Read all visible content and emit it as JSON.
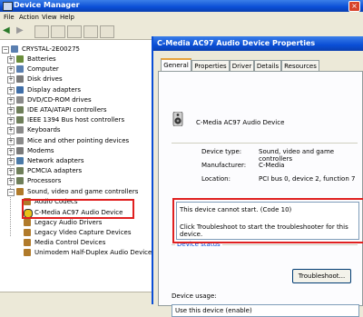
{
  "device_manager": {
    "title": "Device Manager",
    "close_glyph": "×",
    "menu": [
      "File",
      "Action",
      "View",
      "Help"
    ],
    "root": "CRYSTAL-2E00275",
    "tree": [
      {
        "label": "Batteries",
        "icon": "battery-icon",
        "color": "#6a8d3a"
      },
      {
        "label": "Computer",
        "icon": "computer-icon",
        "color": "#5a7fb0"
      },
      {
        "label": "Disk drives",
        "icon": "disk-icon",
        "color": "#7a7a7a"
      },
      {
        "label": "Display adapters",
        "icon": "display-icon",
        "color": "#3f6ea8"
      },
      {
        "label": "DVD/CD-ROM drives",
        "icon": "dvd-icon",
        "color": "#8a8a8a"
      },
      {
        "label": "IDE ATA/ATAPI controllers",
        "icon": "ide-icon",
        "color": "#6f7f5a"
      },
      {
        "label": "IEEE 1394 Bus host controllers",
        "icon": "firewire-icon",
        "color": "#6f7f5a"
      },
      {
        "label": "Keyboards",
        "icon": "keyboard-icon",
        "color": "#8a8a8a"
      },
      {
        "label": "Mice and other pointing devices",
        "icon": "mouse-icon",
        "color": "#8a8a8a"
      },
      {
        "label": "Modems",
        "icon": "modem-icon",
        "color": "#7a7a7a"
      },
      {
        "label": "Network adapters",
        "icon": "network-icon",
        "color": "#4a7aa8"
      },
      {
        "label": "PCMCIA adapters",
        "icon": "pcmcia-icon",
        "color": "#6f7f5a"
      },
      {
        "label": "Processors",
        "icon": "processor-icon",
        "color": "#6f7f5a"
      },
      {
        "label": "Sound, video and game controllers",
        "icon": "sound-icon",
        "color": "#b07a2a",
        "expanded": true
      }
    ],
    "children": [
      {
        "label": "Audio Codecs",
        "icon": "speaker-icon",
        "color": "#b07a2a"
      },
      {
        "label": "C-Media AC97 Audio Device",
        "icon": "warning-icon",
        "color": "#e8c21a"
      },
      {
        "label": "Legacy Audio Drivers",
        "icon": "speaker-icon",
        "color": "#b07a2a"
      },
      {
        "label": "Legacy Video Capture Devices",
        "icon": "speaker-icon",
        "color": "#b07a2a"
      },
      {
        "label": "Media Control Devices",
        "icon": "speaker-icon",
        "color": "#b07a2a"
      },
      {
        "label": "Unimodem Half-Duplex Audio Device",
        "icon": "speaker-icon",
        "color": "#b07a2a"
      }
    ]
  },
  "dialog": {
    "title": "C-Media AC97 Audio Device Properties",
    "tabs": [
      "General",
      "Properties",
      "Driver",
      "Details",
      "Resources"
    ],
    "device_name": "C-Media AC97 Audio Device",
    "props": [
      {
        "key": "Device type:",
        "value": "Sound, video and game controllers"
      },
      {
        "key": "Manufacturer:",
        "value": "C-Media"
      },
      {
        "key": "Location:",
        "value": "PCI bus 0, device 2, function 7"
      }
    ],
    "status_group": "Device status",
    "status_line1": "This device cannot start. (Code 10)",
    "status_line2": "Click Troubleshoot to start the troubleshooter for this device.",
    "troubleshoot_label": "Troubleshoot...",
    "usage_label": "Device usage:",
    "usage_value": "Use this device (enable)"
  },
  "colors": {
    "highlight_red": "#e02020",
    "xp_blue": "#0a4ed6"
  }
}
